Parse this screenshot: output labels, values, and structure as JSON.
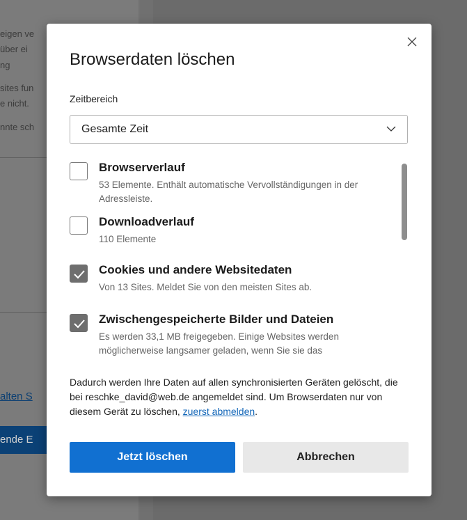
{
  "background": {
    "lines": [
      "eigen ve",
      "über ei",
      "ng",
      "sites fun",
      "e nicht.",
      "nnte sch"
    ],
    "link_text": "alten S",
    "button_text": "ende E"
  },
  "dialog": {
    "title": "Browserdaten löschen",
    "close_icon": "close-icon",
    "time_range": {
      "label": "Zeitbereich",
      "selected": "Gesamte Zeit"
    },
    "items": [
      {
        "title": "Browserverlauf",
        "description": "53 Elemente. Enthält automatische Vervollständigungen in der Adressleiste.",
        "checked": false
      },
      {
        "title": "Downloadverlauf",
        "description": "110 Elemente",
        "checked": false
      },
      {
        "title": "Cookies und andere Websitedaten",
        "description": "Von 13 Sites. Meldet Sie von den meisten Sites ab.",
        "checked": true
      },
      {
        "title": "Zwischengespeicherte Bilder und Dateien",
        "description": "Es werden 33,1 MB freigegeben. Einige Websites werden möglicherweise langsamer geladen, wenn Sie sie das",
        "checked": true
      }
    ],
    "sync_note": {
      "text": "Dadurch werden Ihre Daten auf allen synchronisierten Geräten gelöscht, die bei reschke_david@web.de angemeldet sind. Um Browserdaten nur von diesem Gerät zu löschen, ",
      "link": "zuerst abmelden",
      "end": "."
    },
    "buttons": {
      "confirm": "Jetzt löschen",
      "cancel": "Abbrechen"
    },
    "colors": {
      "primary": "#1170d1",
      "checkbox_checked": "#6e6e6e",
      "link": "#1266b8"
    }
  }
}
